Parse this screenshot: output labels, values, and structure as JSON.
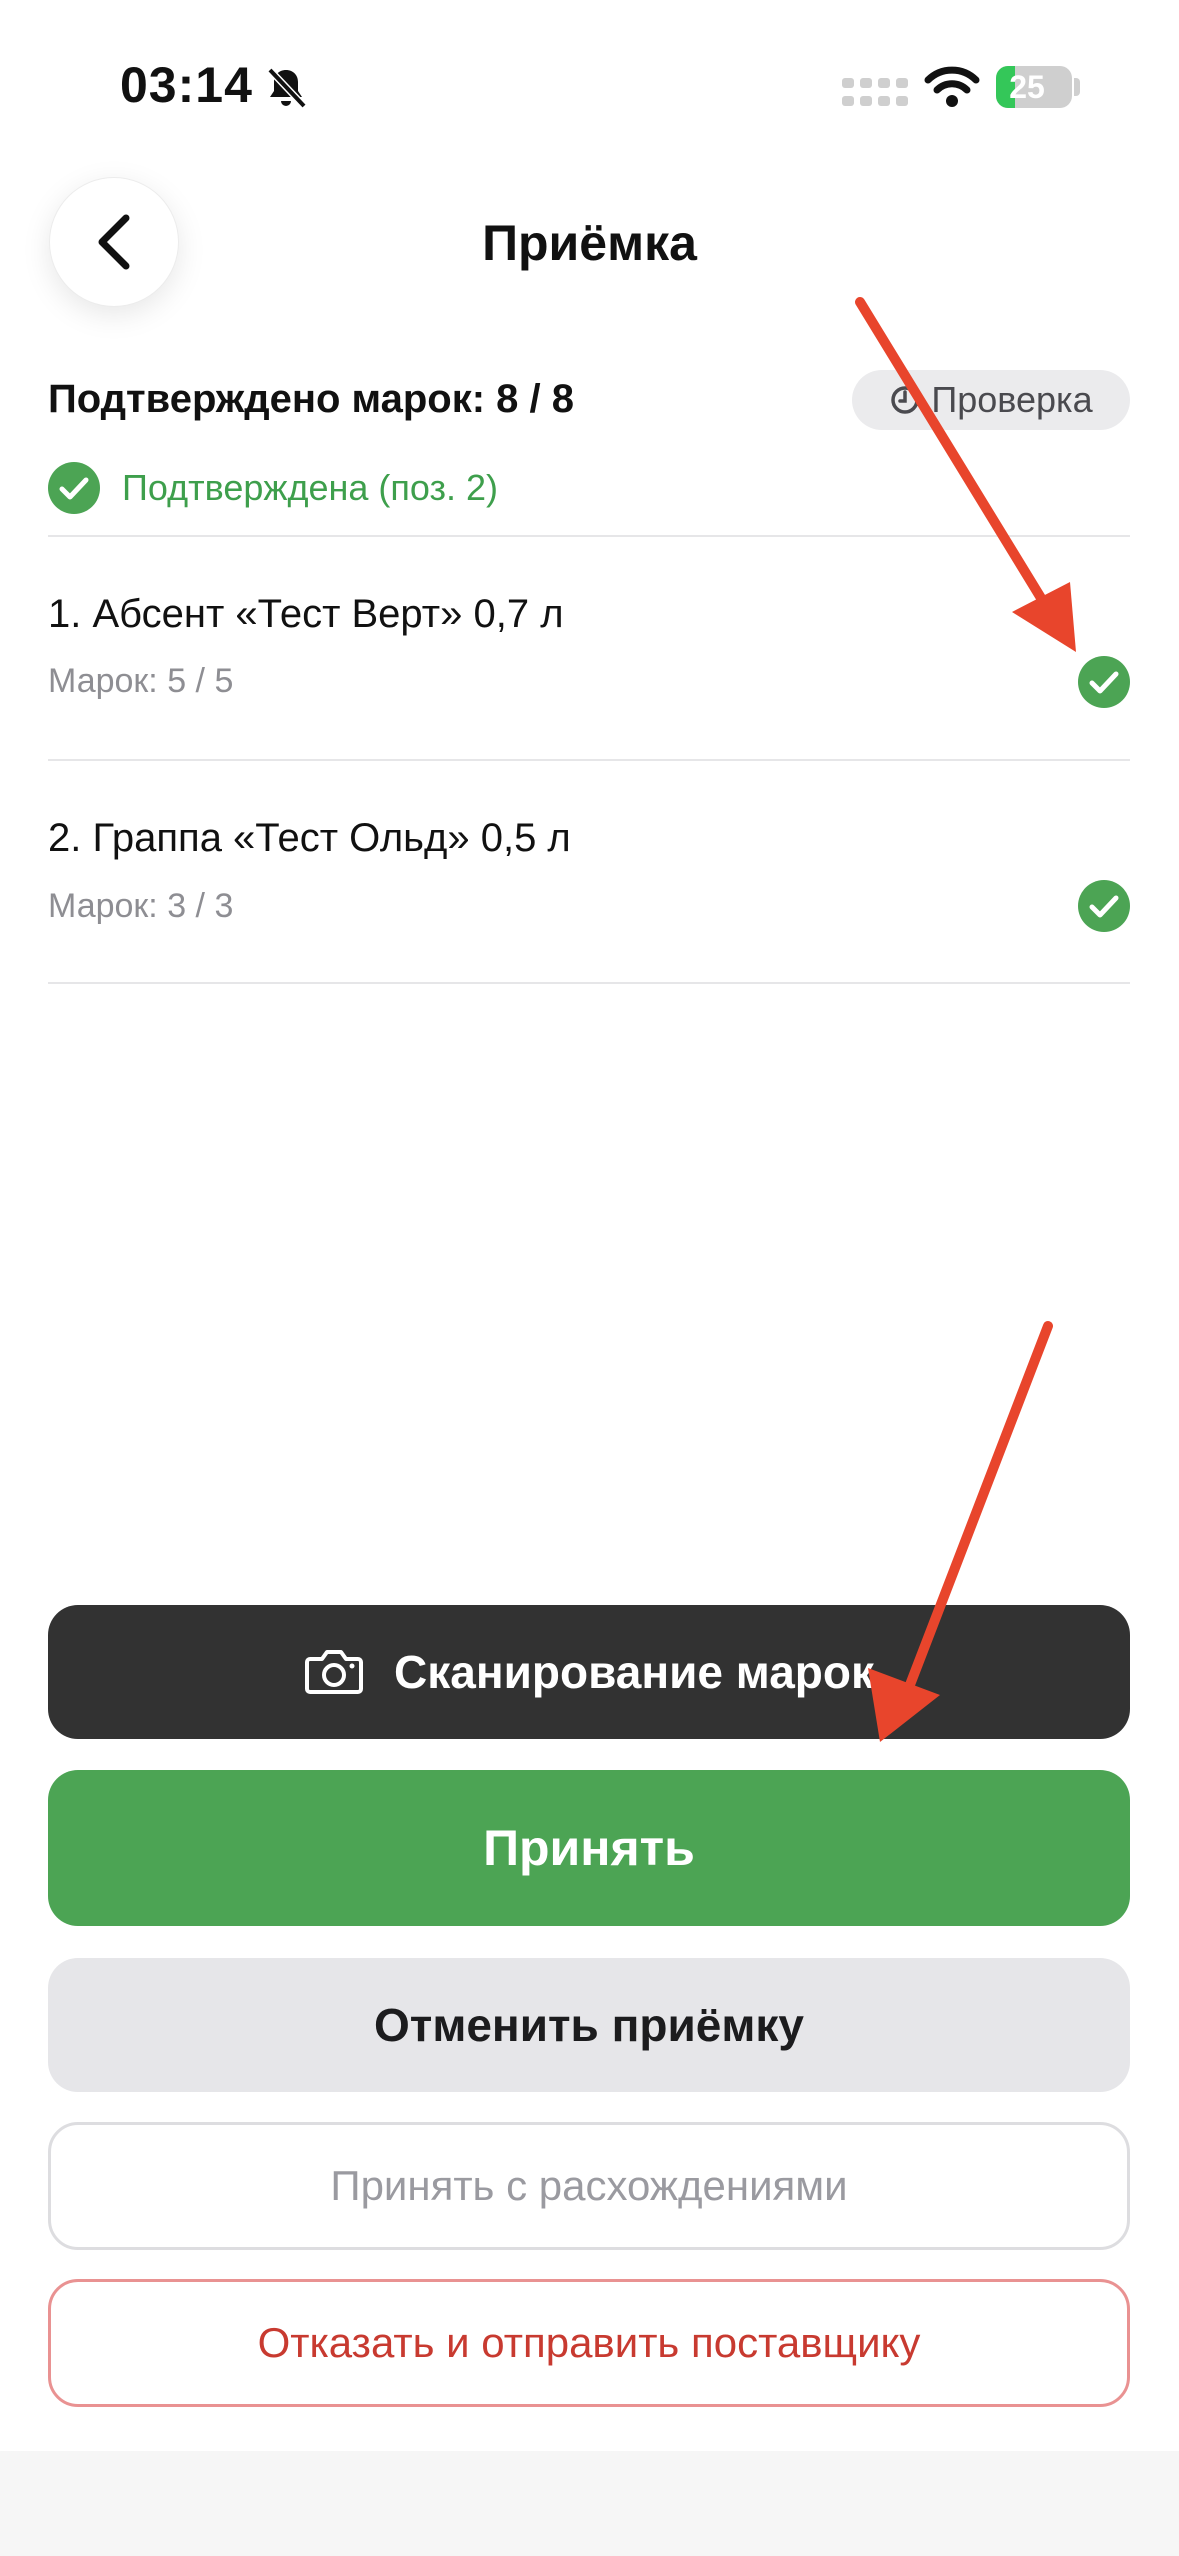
{
  "status_bar": {
    "time": "03:14",
    "battery": "25",
    "battery_level": 0.25
  },
  "header": {
    "title": "Приёмка"
  },
  "summary": {
    "label": "Подтверждено марок: 8 / 8",
    "chip": "Проверка",
    "status": "Подтверждена (поз. 2)"
  },
  "items": [
    {
      "name": "1. Абсент «Тест Верт» 0,7 л",
      "count": "Марок: 5 / 5"
    },
    {
      "name": "2. Граппа «Тест Ольд» 0,5 л",
      "count": "Марок: 3 / 3"
    }
  ],
  "actions": {
    "scan": "Сканирование марок",
    "accept": "Принять",
    "cancel": "Отменить приёмку",
    "accept_diff": "Принять с расхождениями",
    "reject": "Отказать и отправить поставщику"
  },
  "colors": {
    "green": "#4ca454",
    "dark": "#323232",
    "red": "#c83a30",
    "annotation": "#e8452c"
  },
  "icons": [
    "bell-slash-icon",
    "signal-icon",
    "wifi-icon",
    "battery-icon",
    "chevron-left-icon",
    "clock-icon",
    "check-circle-icon",
    "camera-icon",
    "arrow-annotation"
  ]
}
